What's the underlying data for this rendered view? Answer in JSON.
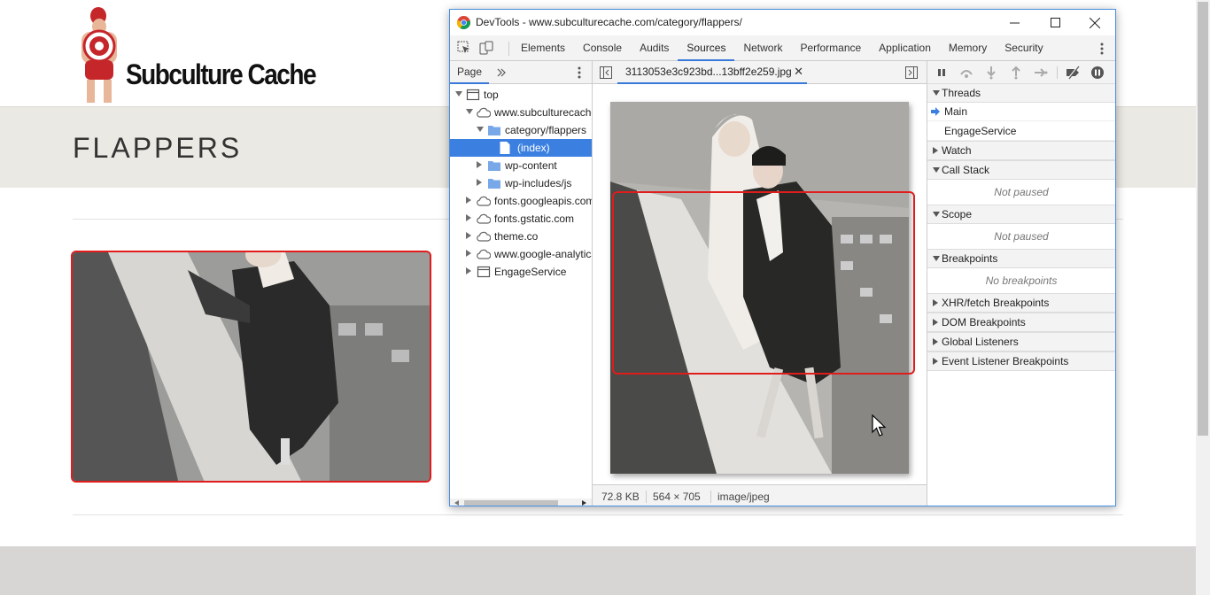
{
  "site": {
    "logo_text": "Subculture Cache",
    "banner_title": "FLAPPERS"
  },
  "devtools": {
    "window_title": "DevTools - www.subculturecache.com/category/flappers/",
    "tabs": [
      {
        "label": "Elements",
        "active": false
      },
      {
        "label": "Console",
        "active": false
      },
      {
        "label": "Audits",
        "active": false
      },
      {
        "label": "Sources",
        "active": true
      },
      {
        "label": "Network",
        "active": false
      },
      {
        "label": "Performance",
        "active": false
      },
      {
        "label": "Application",
        "active": false
      },
      {
        "label": "Memory",
        "active": false
      },
      {
        "label": "Security",
        "active": false
      }
    ],
    "navigator": {
      "tab_label": "Page",
      "tree": [
        {
          "label": "top",
          "icon": "frame-icon"
        },
        {
          "label": "www.subculturecache.com",
          "icon": "cloud-icon"
        },
        {
          "label": "category/flappers",
          "icon": "folder-icon"
        },
        {
          "label": "(index)",
          "icon": "file-icon",
          "selected": true
        },
        {
          "label": "wp-content",
          "icon": "folder-icon"
        },
        {
          "label": "wp-includes/js",
          "icon": "folder-icon"
        },
        {
          "label": "fonts.googleapis.com",
          "icon": "cloud-icon"
        },
        {
          "label": "fonts.gstatic.com",
          "icon": "cloud-icon"
        },
        {
          "label": "theme.co",
          "icon": "cloud-icon"
        },
        {
          "label": "www.google-analytics.com",
          "icon": "cloud-icon"
        },
        {
          "label": "EngageService",
          "icon": "frame-icon"
        }
      ]
    },
    "editor": {
      "open_file": "3113053e3c923bd...13bff2e259.jpg",
      "status": {
        "size": "72.8 KB",
        "dimensions": "564 × 705",
        "mime": "image/jpeg"
      }
    },
    "debugger": {
      "sections": {
        "threads": "Threads",
        "watch": "Watch",
        "call_stack": "Call Stack",
        "scope": "Scope",
        "breakpoints": "Breakpoints",
        "xhr": "XHR/fetch Breakpoints",
        "dom": "DOM Breakpoints",
        "global": "Global Listeners",
        "event": "Event Listener Breakpoints"
      },
      "threads": [
        "Main",
        "EngageService"
      ],
      "call_stack_msg": "Not paused",
      "scope_msg": "Not paused",
      "breakpoints_msg": "No breakpoints"
    }
  },
  "colors": {
    "accent_blue": "#3879d9",
    "selection_blue": "#3b80e0",
    "highlight_red": "#e01c1c"
  }
}
